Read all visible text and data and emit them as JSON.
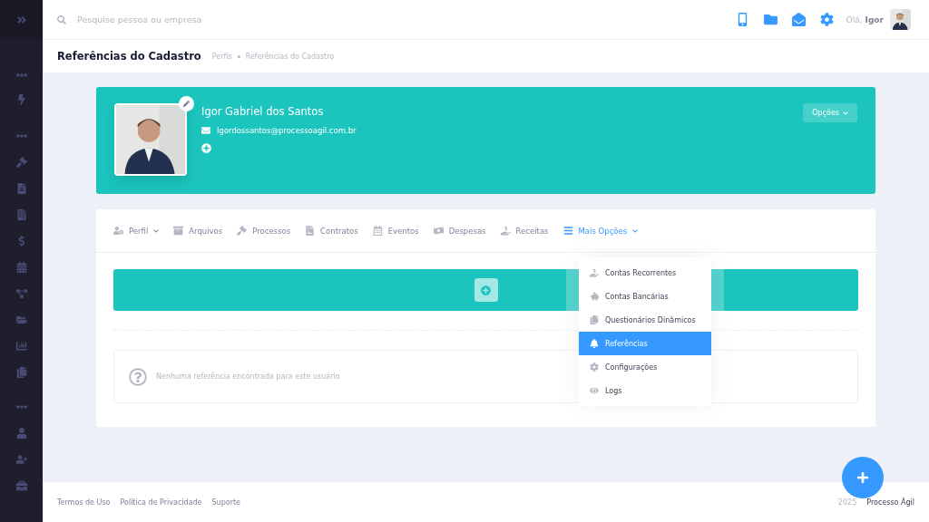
{
  "topbar": {
    "search": {
      "placeholder": "Pesquise pessoa ou empresa"
    },
    "greeting": "Olá,",
    "user": "Igor"
  },
  "subheader": {
    "title": "Referências do Cadastro",
    "breadcrumbs": [
      "Perfis",
      "Referências do Cadastro"
    ]
  },
  "profile": {
    "name": "Igor Gabriel dos Santos",
    "email": "Igordossantos@processoagil.com.br",
    "options_button": "Opções"
  },
  "tabs": [
    {
      "label": "Perfil",
      "selected": false,
      "dropdown": true
    },
    {
      "label": "Arquivos",
      "selected": false,
      "dropdown": false
    },
    {
      "label": "Processos",
      "selected": false,
      "dropdown": false
    },
    {
      "label": "Contratos",
      "selected": false,
      "dropdown": false
    },
    {
      "label": "Eventos",
      "selected": false,
      "dropdown": false
    },
    {
      "label": "Despesas",
      "selected": false,
      "dropdown": false
    },
    {
      "label": "Receitas",
      "selected": false,
      "dropdown": false
    },
    {
      "label": "Mais Opções",
      "selected": true,
      "dropdown": true
    }
  ],
  "menu": [
    {
      "label": "Contas Recorrentes",
      "selected": false
    },
    {
      "label": "Contas Bancárias",
      "selected": false
    },
    {
      "label": "Questionários Dinâmicos",
      "selected": false
    },
    {
      "label": "Referências",
      "selected": true
    },
    {
      "label": "Configurações",
      "selected": false
    },
    {
      "label": "Logs",
      "selected": false
    }
  ],
  "empty_message": "Nenhuma referência encontrada para este usuário",
  "footer": {
    "links": [
      "Termos de Uso",
      "Política de Privacidade",
      "Suporte"
    ],
    "year": "2025",
    "brand": "Processo Ágil"
  }
}
